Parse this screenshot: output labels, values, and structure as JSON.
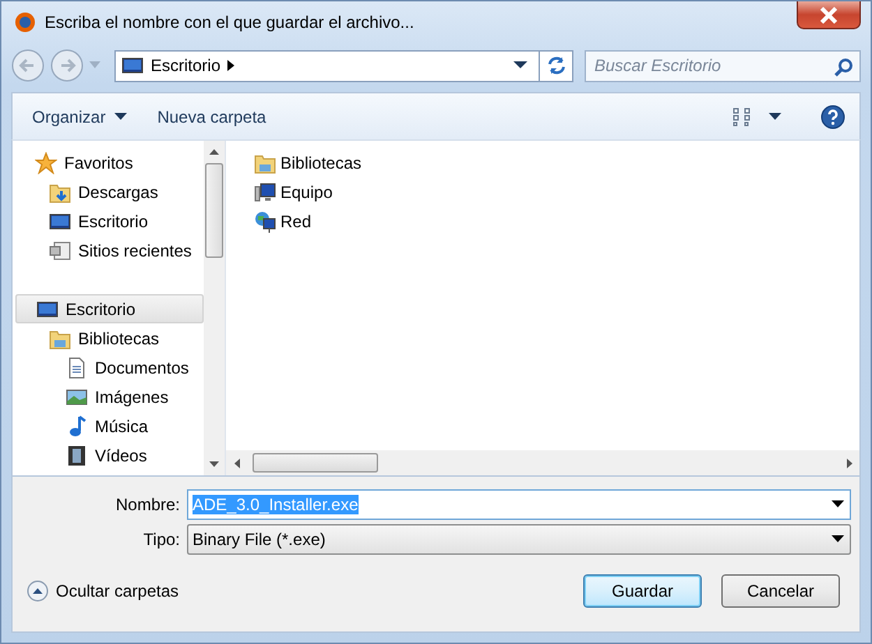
{
  "window": {
    "title": "Escriba el nombre con el que guardar el archivo..."
  },
  "address": {
    "location": "Escritorio"
  },
  "search": {
    "placeholder": "Buscar Escritorio"
  },
  "toolbar": [
    {
      "label": "Organizar",
      "kind": "menu"
    },
    {
      "label": "Nueva carpeta",
      "kind": "button"
    }
  ],
  "nav_tree": [
    {
      "label": "Favoritos",
      "kind": "star",
      "selected": false,
      "children": [
        {
          "label": "Descargas",
          "kind": "download",
          "selected": false
        },
        {
          "label": "Escritorio",
          "kind": "desktop",
          "selected": false
        },
        {
          "label": "Sitios recientes",
          "kind": "recent",
          "selected": false
        }
      ]
    },
    {
      "label": "Escritorio",
      "kind": "desktop",
      "selected": true,
      "children": [
        {
          "label": "Bibliotecas",
          "kind": "library",
          "selected": false,
          "children": [
            {
              "label": "Documentos",
              "kind": "document",
              "selected": false
            },
            {
              "label": "Imágenes",
              "kind": "image",
              "selected": false
            },
            {
              "label": "Música",
              "kind": "music",
              "selected": false
            },
            {
              "label": "Vídeos",
              "kind": "video",
              "selected": false
            }
          ]
        }
      ]
    }
  ],
  "files": [
    {
      "name": "Bibliotecas",
      "kind": "library"
    },
    {
      "name": "Equipo",
      "kind": "computer"
    },
    {
      "name": "Red",
      "kind": "network"
    }
  ],
  "fields": [
    {
      "label": "Nombre:",
      "value": "ADE_3.0_Installer.exe",
      "kind": "combo",
      "text_selected": true
    },
    {
      "label": "Tipo:",
      "value": "Binary File (*.exe)",
      "kind": "dropdown",
      "text_selected": false
    }
  ],
  "hide_folders": {
    "label": "Ocultar carpetas"
  },
  "buttons": [
    {
      "label": "Guardar",
      "default": true
    },
    {
      "label": "Cancelar",
      "default": false
    }
  ]
}
